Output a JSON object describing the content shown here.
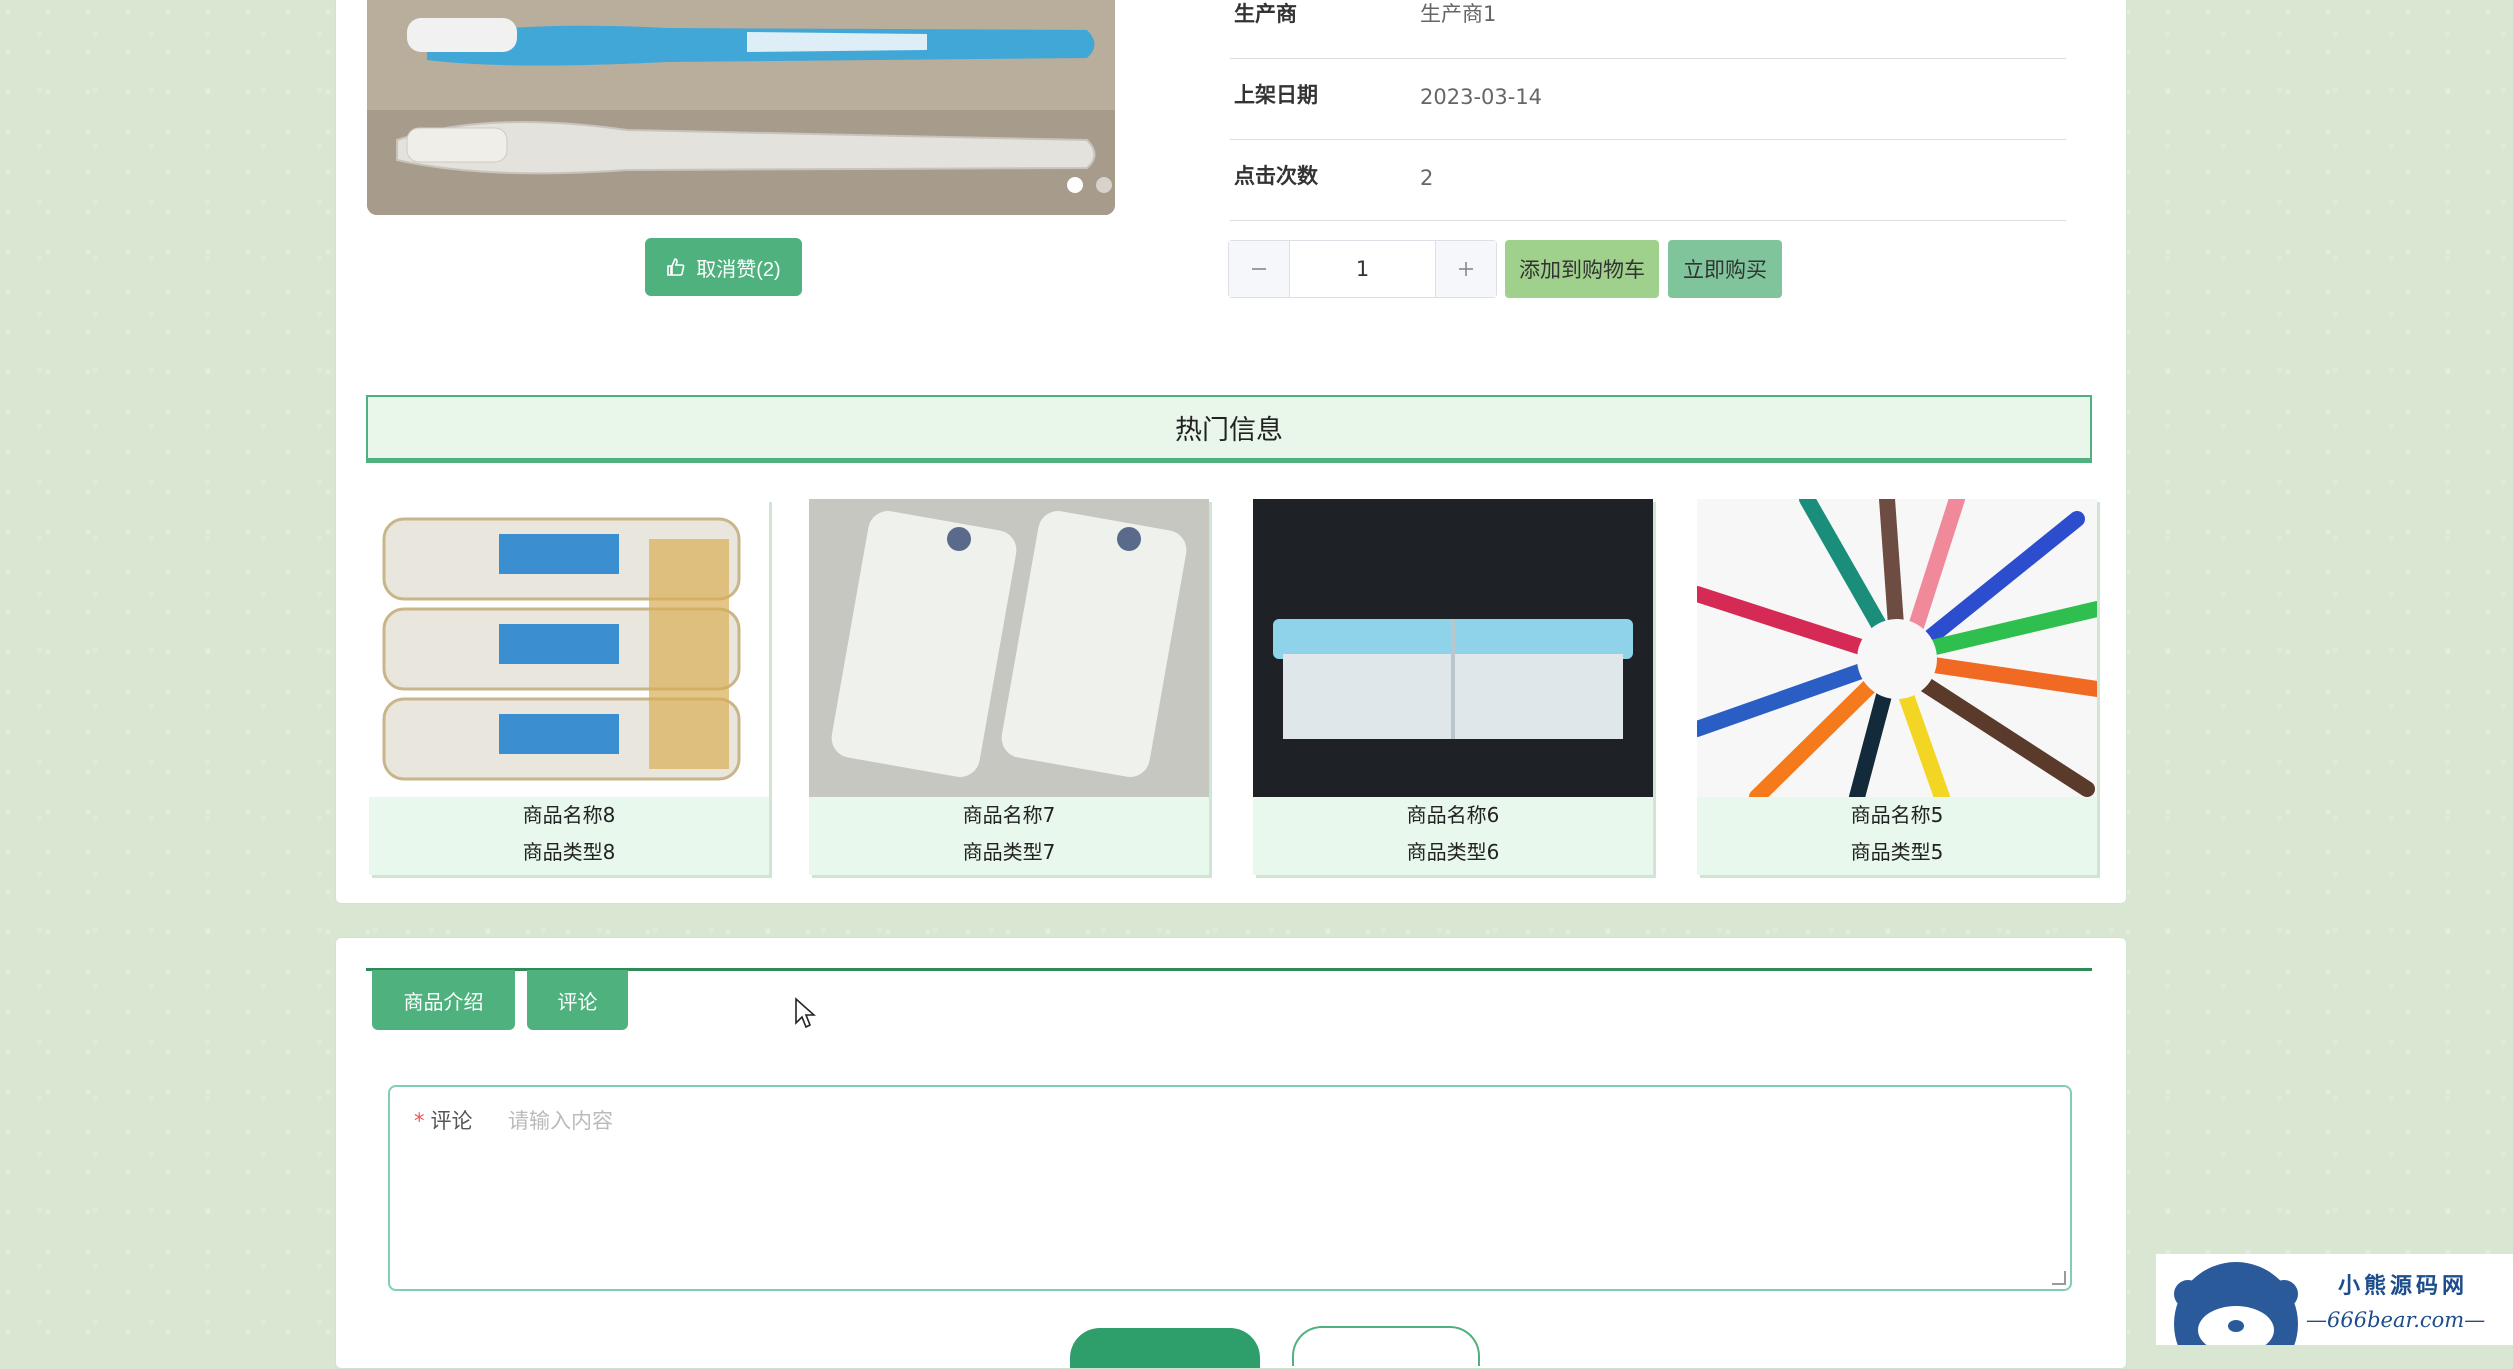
{
  "product": {
    "rows": [
      {
        "label": "生产商",
        "value": "生产商1"
      },
      {
        "label": "上架日期",
        "value": "2023-03-14"
      },
      {
        "label": "点击次数",
        "value": "2"
      }
    ],
    "like_label": "取消赞(2)",
    "quantity": "1",
    "add_to_cart": "添加到购物车",
    "buy_now": "立即购买",
    "carousel_active_index": 0,
    "carousel_count": 3
  },
  "hot": {
    "title": "热门信息",
    "items": [
      {
        "name": "商品名称8",
        "type": "商品类型8"
      },
      {
        "name": "商品名称7",
        "type": "商品类型7"
      },
      {
        "name": "商品名称6",
        "type": "商品类型6"
      },
      {
        "name": "商品名称5",
        "type": "商品类型5"
      }
    ]
  },
  "tabs": [
    {
      "label": "商品介绍"
    },
    {
      "label": "评论"
    }
  ],
  "comment": {
    "label": "评论",
    "required_mark": "*",
    "placeholder": "请输入内容"
  },
  "watermark": {
    "title": "小熊源码网",
    "url": "—666bear.com—"
  },
  "colors": {
    "accent": "#4fb27e",
    "accent_dark": "#2e8b57",
    "hot_bg": "#e8f7ea",
    "page_bg": "#d9e6d2"
  }
}
